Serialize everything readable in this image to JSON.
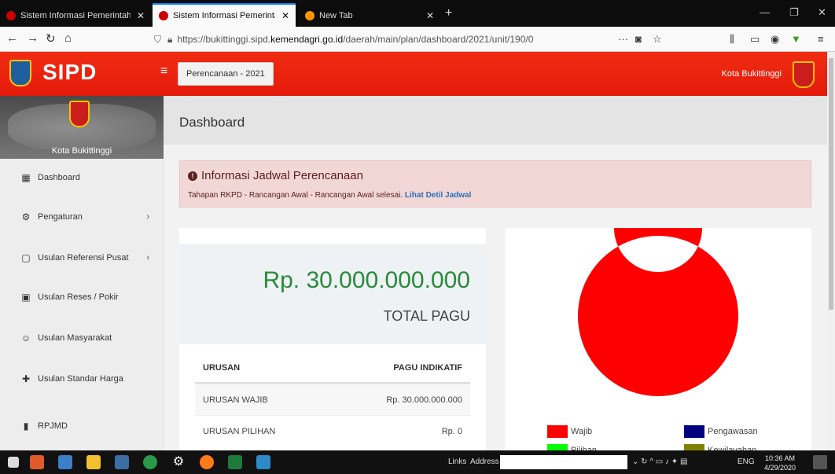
{
  "browser": {
    "tabs": [
      {
        "title": "Sistem Informasi Pemerintahan",
        "active": false
      },
      {
        "title": "Sistem Informasi Pemerintahan",
        "active": true
      },
      {
        "title": "New Tab",
        "active": false
      }
    ],
    "url": {
      "prefix": "https://bukittinggi.sipd.",
      "host": "kemendagri.go.id",
      "path": "/daerah/main/plan/dashboard/2021/unit/190/0"
    }
  },
  "header": {
    "brand": "SIPD",
    "plan_label": "Perencanaan - 2021",
    "city": "Kota Bukittinggi"
  },
  "sidebar": {
    "city": "Kota Bukittinggi",
    "items": [
      {
        "label": "Dashboard",
        "icon": "dashboard-icon",
        "has_children": false
      },
      {
        "label": "Pengaturan",
        "icon": "gear-icon",
        "has_children": true
      },
      {
        "label": "Usulan Referensi Pusat",
        "icon": "comment-icon",
        "has_children": true
      },
      {
        "label": "Usulan Reses / Pokir",
        "icon": "chat-icon",
        "has_children": false
      },
      {
        "label": "Usulan Masyarakat",
        "icon": "people-chat-icon",
        "has_children": false
      },
      {
        "label": "Usulan Standar Harga",
        "icon": "puzzle-icon",
        "has_children": false
      },
      {
        "label": "RPJMD",
        "icon": "document-icon",
        "has_children": false
      }
    ]
  },
  "main": {
    "title": "Dashboard",
    "alert": {
      "title": "Informasi Jadwal Perencanaan",
      "body": "Tahapan RKPD - Rancangan Awal - Rancangan Awal selesai.",
      "link": "Lihat Detil Jadwal"
    },
    "total": {
      "amount": "Rp. 30.000.000.000",
      "label": "TOTAL PAGU"
    },
    "table": {
      "headers": [
        "URUSAN",
        "PAGU INDIKATIF"
      ],
      "rows": [
        [
          "URUSAN WAJIB",
          "Rp. 30.000.000.000"
        ],
        [
          "URUSAN PILIHAN",
          "Rp. 0"
        ]
      ]
    }
  },
  "chart_data": {
    "type": "pie",
    "donut": true,
    "labels": [
      "Wajib",
      "Pilihan",
      "Pengawasan",
      "Kewilayahan"
    ],
    "values": [
      30000000000,
      0,
      0,
      0
    ],
    "colors": [
      "#ff0000",
      "#00ff00",
      "#000080",
      "#808000"
    ]
  },
  "taskbar": {
    "links_label": "Links",
    "address_label": "Address",
    "lang": "ENG",
    "time": "10:36 AM",
    "date": "4/29/2020"
  }
}
